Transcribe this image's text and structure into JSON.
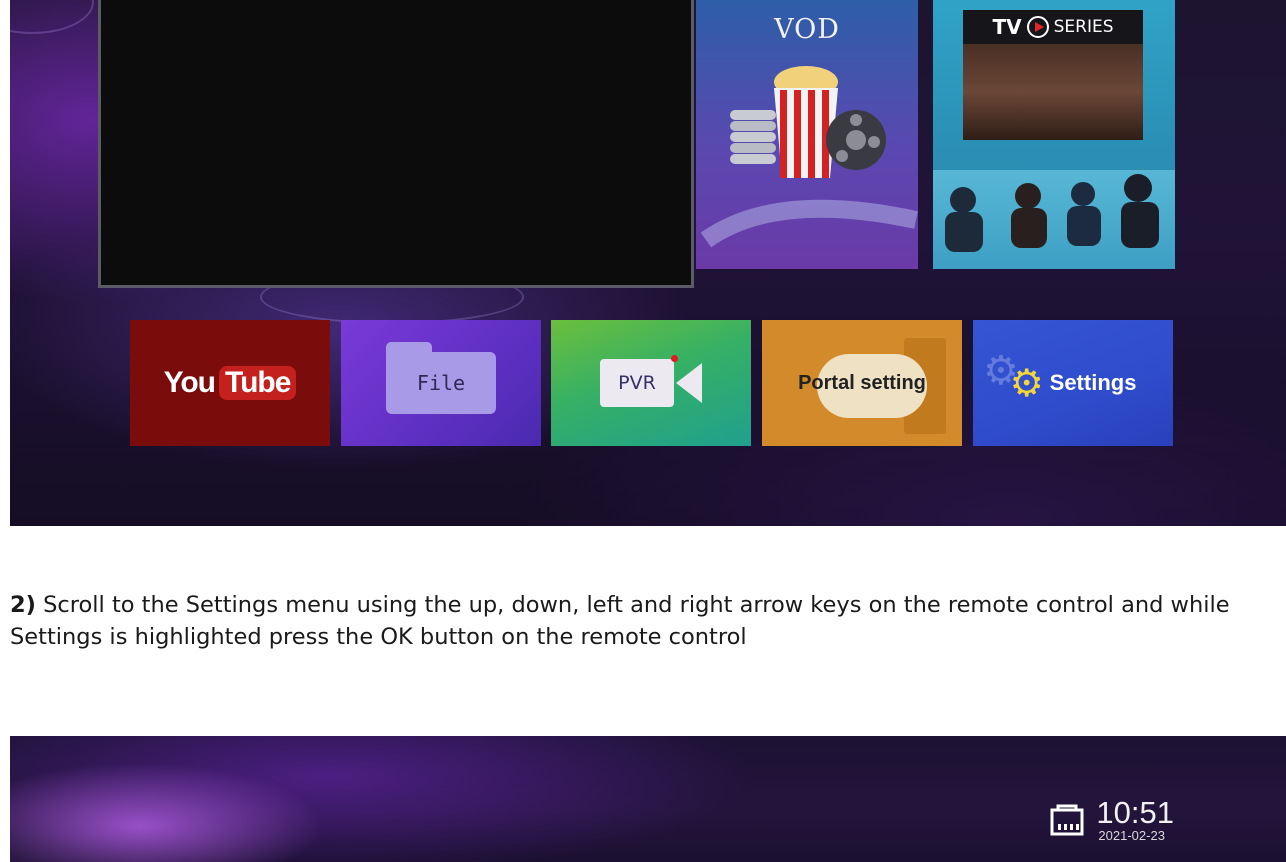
{
  "top_screen": {
    "tiles": {
      "vod": "VOD",
      "series_brand_tv": "TV",
      "series_brand_series": "SERIES",
      "youtube_you": "You",
      "youtube_tube": "Tube",
      "file": "File",
      "pvr": "PVR",
      "portal": "Portal setting",
      "settings": "Settings"
    },
    "colors": {
      "youtube": "#7a0c0c",
      "file": "#6a34cc",
      "pvr": "#36b065",
      "portal": "#d28a2a",
      "settings": "#2f4ccc"
    }
  },
  "instruction": {
    "step": "2)",
    "text": "Scroll to the Settings menu using the up, down, left and right arrow keys on the remote control and while Settings is highlighted press the OK button on the remote control"
  },
  "bottom_screen": {
    "status": {
      "network_icon": "ethernet-icon",
      "time": "10:51",
      "date": "2021-02-23"
    }
  }
}
